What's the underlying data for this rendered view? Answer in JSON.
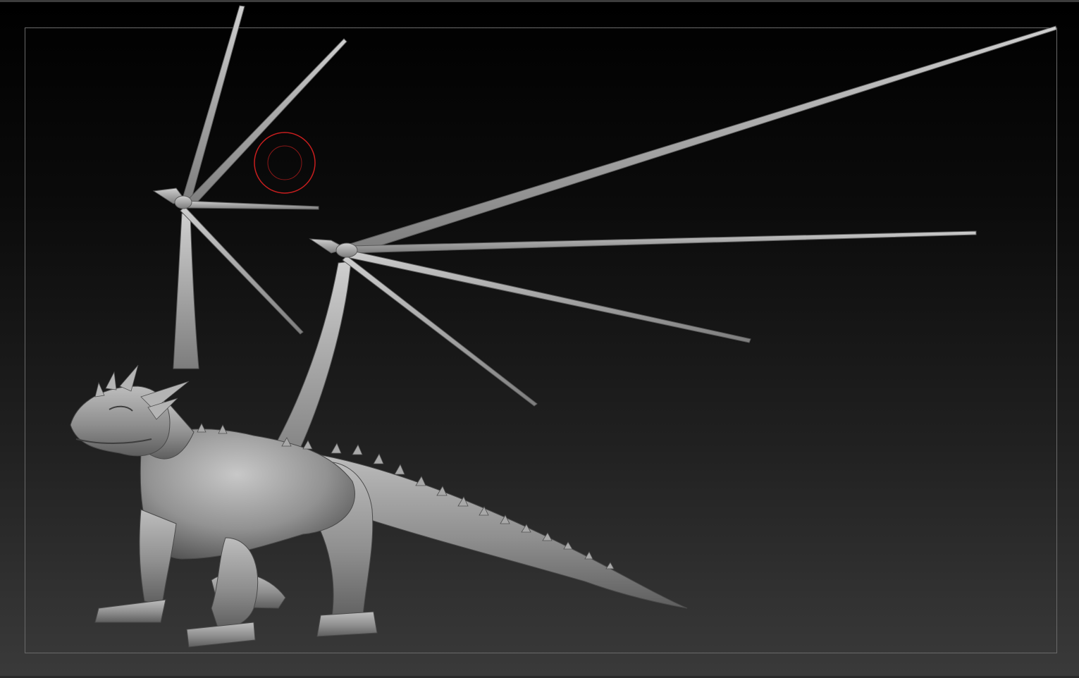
{
  "app": {
    "canvas_color": "#000000",
    "floor_color": "#3a3a3a",
    "frame_color": "#6a6a6a"
  },
  "model": {
    "subject": "dragon-sculpt",
    "material_color": "#9a9a9a",
    "highlight_color": "#c4c4c4",
    "shadow_color": "#4e4e4e"
  },
  "brush_cursor": {
    "icon": "brush-draw-size-icon",
    "color": "#c81e1e"
  }
}
